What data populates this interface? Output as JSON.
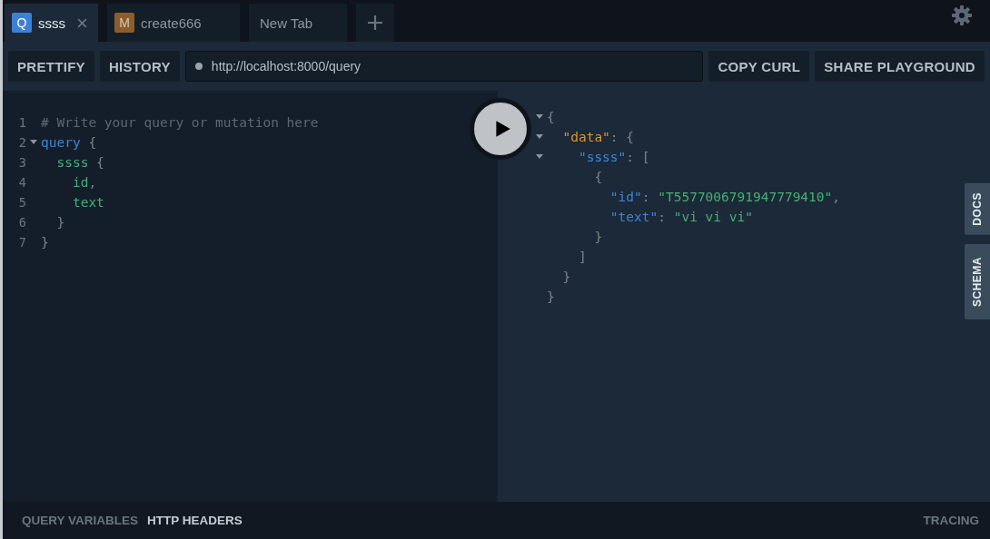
{
  "tabs": [
    {
      "badge": "Q",
      "color": "#3d80d6",
      "label": "ssss",
      "selected": true,
      "closable": true
    },
    {
      "badge": "M",
      "color": "#8a5e2c",
      "label": "create666",
      "selected": false,
      "closable": false
    },
    {
      "label": "New Tab",
      "selected": false,
      "closable": false
    }
  ],
  "toolbar": {
    "left_buttons": [
      "PRETTIFY",
      "HISTORY"
    ],
    "endpoint": "http://localhost:8000/query",
    "right_buttons": [
      "COPY CURL",
      "SHARE PLAYGROUND"
    ]
  },
  "editor": {
    "lines": [
      {
        "number": "1",
        "foldable": false,
        "tokens": [
          {
            "kind": "comment",
            "text": "# Write your query or mutation here"
          }
        ]
      },
      {
        "number": "2",
        "foldable": true,
        "tokens": [
          {
            "kind": "keyword",
            "text": "query"
          },
          {
            "kind": "punct",
            "text": " {"
          }
        ]
      },
      {
        "number": "3",
        "foldable": false,
        "tokens": [
          {
            "kind": "field",
            "text": "  ssss"
          },
          {
            "kind": "punct",
            "text": " {"
          }
        ]
      },
      {
        "number": "4",
        "foldable": false,
        "tokens": [
          {
            "kind": "field",
            "text": "    id"
          },
          {
            "kind": "punct",
            "text": ","
          }
        ]
      },
      {
        "number": "5",
        "foldable": false,
        "tokens": [
          {
            "kind": "field",
            "text": "    text"
          }
        ]
      },
      {
        "number": "6",
        "foldable": false,
        "tokens": [
          {
            "kind": "punct",
            "text": "  }"
          }
        ]
      },
      {
        "number": "7",
        "foldable": false,
        "tokens": [
          {
            "kind": "punct",
            "text": "}"
          }
        ]
      }
    ]
  },
  "result": {
    "lines": [
      {
        "foldable": true,
        "tokens": [
          {
            "kind": "punct",
            "text": "{"
          }
        ]
      },
      {
        "foldable": true,
        "tokens": [
          {
            "kind": "rootkey",
            "text": "  \"data\""
          },
          {
            "kind": "punct",
            "text": ": {"
          }
        ]
      },
      {
        "foldable": true,
        "tokens": [
          {
            "kind": "key",
            "text": "    \"ssss\""
          },
          {
            "kind": "punct",
            "text": ": ["
          }
        ]
      },
      {
        "foldable": false,
        "tokens": [
          {
            "kind": "punct",
            "text": "      {"
          }
        ]
      },
      {
        "foldable": false,
        "tokens": [
          {
            "kind": "key",
            "text": "        \"id\""
          },
          {
            "kind": "punct",
            "text": ": "
          },
          {
            "kind": "string",
            "text": "\"T5577006791947779410\""
          },
          {
            "kind": "punct",
            "text": ","
          }
        ]
      },
      {
        "foldable": false,
        "tokens": [
          {
            "kind": "key",
            "text": "        \"text\""
          },
          {
            "kind": "punct",
            "text": ": "
          },
          {
            "kind": "string",
            "text": "\"vi vi vi\""
          }
        ]
      },
      {
        "foldable": false,
        "tokens": [
          {
            "kind": "punct",
            "text": "      }"
          }
        ]
      },
      {
        "foldable": false,
        "tokens": [
          {
            "kind": "punct",
            "text": "    ]"
          }
        ]
      },
      {
        "foldable": false,
        "tokens": [
          {
            "kind": "punct",
            "text": "  }"
          }
        ]
      },
      {
        "foldable": false,
        "tokens": [
          {
            "kind": "punct",
            "text": "}"
          }
        ]
      }
    ]
  },
  "side_tabs": [
    "DOCS",
    "SCHEMA"
  ],
  "bottom_bar": {
    "tabs": [
      {
        "label": "QUERY VARIABLES",
        "selected": false
      },
      {
        "label": "HTTP HEADERS",
        "selected": true
      }
    ],
    "tracing": "TRACING"
  }
}
